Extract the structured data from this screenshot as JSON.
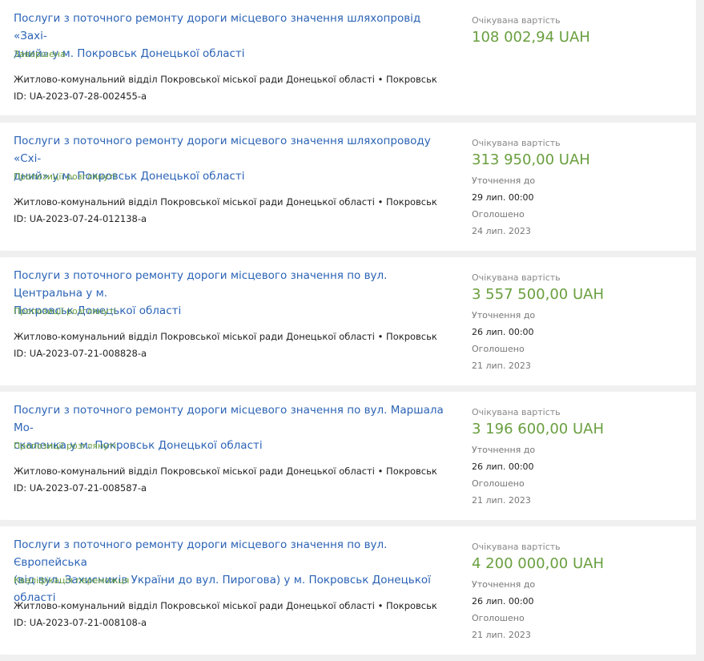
{
  "tenders": [
    {
      "title": "Послуги з поточного ремонту дороги місцевого значення шляхопровід «Західний» у м. Покровськ Донецької області",
      "title_lines": [
        "Послуги з поточного ремонту дороги місцевого значення шляхопровід «Захі-",
        "дний» у м. Покровськ Донецької області"
      ],
      "status": "Завершена",
      "organization": "Житлово-комунальний відділ Покровської міської ради Донецької області • Покровськ",
      "id": "ID: UA-2023-07-28-002455-a",
      "expected_label": "Очікувана вартість",
      "amount": "108 002,94 UAH"
    },
    {
      "title_lines": [
        "Послуги з поточного ремонту дороги місцевого значення шляхопроводу «Схі-",
        "дний» у м. Покровськ Донецької області"
      ],
      "status": "Пропозиції розглянуті",
      "organization": "Житлово-комунальний відділ Покровської міської ради Донецької області • Покровськ",
      "id": "ID: UA-2023-07-24-012138-a",
      "expected_label": "Очікувана вартість",
      "amount": "313 950,00 UAH",
      "clarification_label": "Уточнення до",
      "clarification_date": "29 лип. 00:00",
      "announced_label": "Оголошено",
      "announced_date": "24 лип. 2023"
    },
    {
      "title_lines": [
        "Послуги з поточного ремонту дороги місцевого значення по вул. Центральна у м.",
        "Покровськ Донецької області"
      ],
      "status": "Пропозиції розглянуті",
      "organization": "Житлово-комунальний відділ Покровської міської ради Донецької області • Покровськ",
      "id": "ID: UA-2023-07-21-008828-a",
      "expected_label": "Очікувана вартість",
      "amount": "3 557 500,00 UAH",
      "clarification_label": "Уточнення до",
      "clarification_date": "26 лип. 00:00",
      "announced_label": "Оголошено",
      "announced_date": "21 лип. 2023"
    },
    {
      "title_lines": [
        "Послуги з поточного ремонту дороги місцевого значення по вул. Маршала Мо-",
        "скаленка у м. Покровськ Донецької області"
      ],
      "status": "Пропозиції розглянуті",
      "organization": "Житлово-комунальний відділ Покровської міської ради Донецької області • Покровськ",
      "id": "ID: UA-2023-07-21-008587-a",
      "expected_label": "Очікувана вартість",
      "amount": "3 196 600,00 UAH",
      "clarification_label": "Уточнення до",
      "clarification_date": "26 лип. 00:00",
      "announced_label": "Оголошено",
      "announced_date": "21 лип. 2023"
    },
    {
      "title_lines": [
        "Послуги з поточного ремонту дороги місцевого значення по вул. Європейська",
        "(від вул. Захисників України до вул. Пирогова) у м. Покровськ Донецької області"
      ],
      "status": "Кваліфікація переможця",
      "organization": "Житлово-комунальний відділ Покровської міської ради Донецької області • Покровськ",
      "id": "ID: UA-2023-07-21-008108-a",
      "expected_label": "Очікувана вартість",
      "amount": "4 200 000,00 UAH",
      "clarification_label": "Уточнення до",
      "clarification_date": "26 лип. 00:00",
      "announced_label": "Оголошено",
      "announced_date": "21 лип. 2023"
    }
  ],
  "colors": {
    "link": "#2b63b6",
    "accent_green": "#6a9f3f",
    "background": "#f0f0f0",
    "card": "#ffffff"
  }
}
